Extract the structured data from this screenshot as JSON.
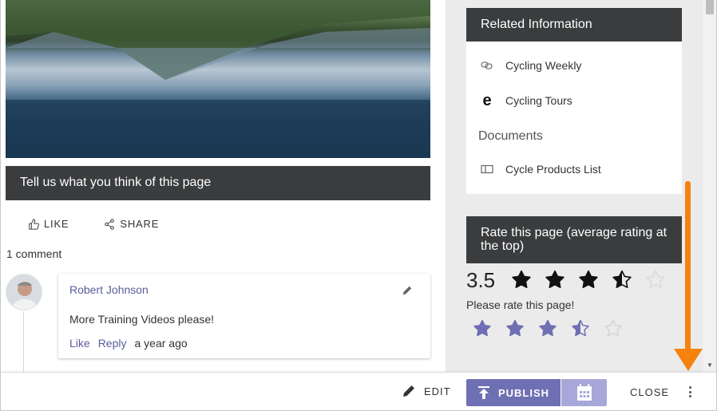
{
  "feedback": {
    "title": "Tell us what you think of this page",
    "like_label": "LIKE",
    "share_label": "SHARE",
    "comment_count": "1 comment"
  },
  "comment": {
    "author": "Robert Johnson",
    "text": "More Training Videos please!",
    "like_label": "Like",
    "reply_label": "Reply",
    "time": "a year ago"
  },
  "related": {
    "title": "Related Information",
    "items": [
      {
        "label": "Cycling Weekly",
        "icon": "link-icon"
      },
      {
        "label": "Cycling Tours",
        "icon": "edge-browser-icon"
      }
    ],
    "documents_label": "Documents",
    "documents": [
      {
        "label": "Cycle Products List",
        "icon": "document-page-icon"
      }
    ]
  },
  "rating": {
    "title": "Rate this page (average rating at the top)",
    "average": "3.5",
    "average_stars": 3.5,
    "prompt": "Please rate this page!",
    "user_stars": 3.5,
    "max_stars": 5
  },
  "toolbar": {
    "edit_label": "EDIT",
    "publish_label": "PUBLISH",
    "close_label": "CLOSE"
  },
  "colors": {
    "header_bg": "#3a3c3e",
    "accent": "#6f6fb4",
    "accent_light": "#a7a7d9",
    "link": "#5a5d9d",
    "annotation_arrow": "#f5820d"
  }
}
